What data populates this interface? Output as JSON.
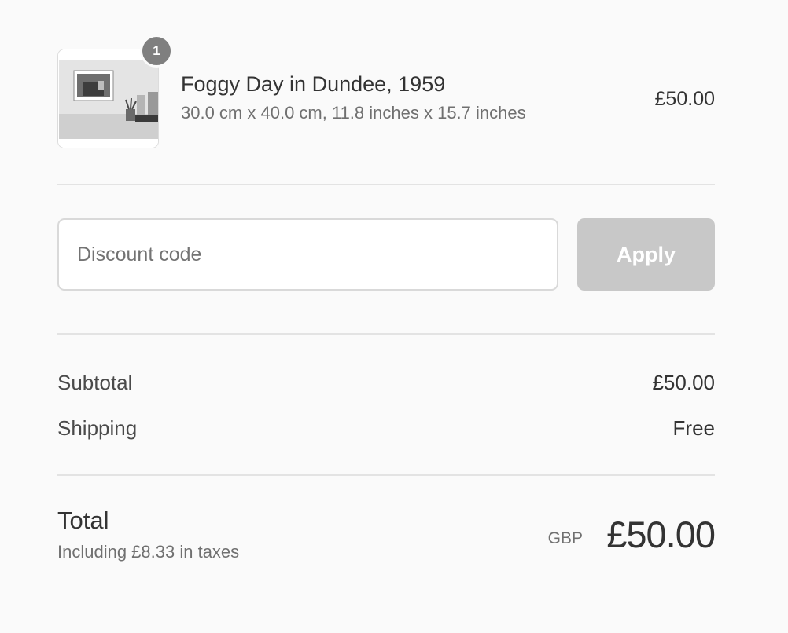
{
  "product": {
    "quantity": "1",
    "name": "Foggy Day in Dundee, 1959",
    "variant": "30.0 cm x 40.0 cm, 11.8 inches x 15.7 inches",
    "price": "£50.00"
  },
  "discount": {
    "placeholder": "Discount code",
    "apply_label": "Apply"
  },
  "costs": {
    "subtotal_label": "Subtotal",
    "subtotal_value": "£50.00",
    "shipping_label": "Shipping",
    "shipping_value": "Free"
  },
  "total": {
    "label": "Total",
    "tax_note": "Including £8.33 in taxes",
    "currency": "GBP",
    "value": "£50.00"
  },
  "colors": {
    "background": "#fafafa",
    "apply_disabled": "#c8c8c8",
    "badge": "#7f7f7f",
    "divider": "#e3e3e3"
  }
}
